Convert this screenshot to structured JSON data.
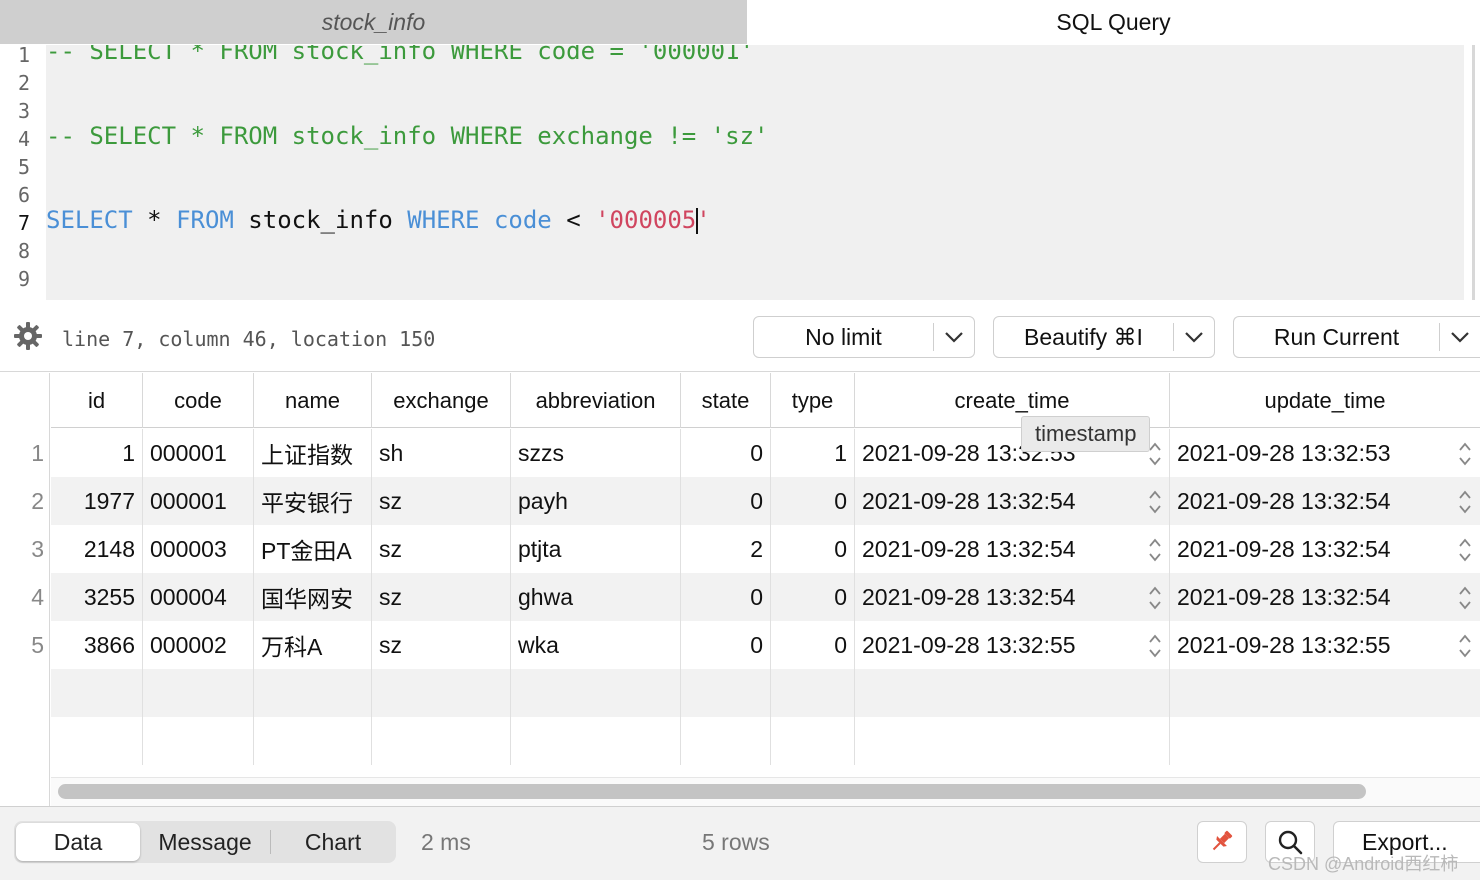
{
  "tabs": [
    {
      "label": "stock_info",
      "active": false
    },
    {
      "label": "SQL Query",
      "active": true
    }
  ],
  "editor": {
    "line_numbers": [
      "1",
      "2",
      "3",
      "4",
      "5",
      "6",
      "7",
      "8",
      "9"
    ],
    "current_line": "7",
    "lines": {
      "l1": "-- SELECT * FROM stock_info WHERE code = '000001'",
      "l4": "-- SELECT * FROM stock_info WHERE exchange != 'sz'",
      "l7_kw1": "SELECT",
      "l7_p1": " * ",
      "l7_kw2": "FROM",
      "l7_p2": " stock_info ",
      "l7_kw3": "WHERE",
      "l7_p3": " ",
      "l7_kw4": "code",
      "l7_p4": " < ",
      "l7_str_a": "'000005",
      "l7_str_b": "'"
    }
  },
  "toolbar": {
    "cursor_status": "line 7, column 46, location 150",
    "limit_label": "No limit",
    "beautify_label": "Beautify ⌘I",
    "run_label": "Run Current"
  },
  "grid": {
    "columns": [
      "id",
      "code",
      "name",
      "exchange",
      "abbreviation",
      "state",
      "type",
      "create_time",
      "update_time"
    ],
    "rows": [
      {
        "num": "1",
        "id": "1",
        "code": "000001",
        "name": "上证指数",
        "exchange": "sh",
        "abbreviation": "szzs",
        "state": "0",
        "type": "1",
        "create_time": "2021-09-28 13:32:53",
        "update_time": "2021-09-28 13:32:53"
      },
      {
        "num": "2",
        "id": "1977",
        "code": "000001",
        "name": "平安银行",
        "exchange": "sz",
        "abbreviation": "payh",
        "state": "0",
        "type": "0",
        "create_time": "2021-09-28 13:32:54",
        "update_time": "2021-09-28 13:32:54"
      },
      {
        "num": "3",
        "id": "2148",
        "code": "000003",
        "name": "PT金田A",
        "exchange": "sz",
        "abbreviation": "ptjta",
        "state": "2",
        "type": "0",
        "create_time": "2021-09-28 13:32:54",
        "update_time": "2021-09-28 13:32:54"
      },
      {
        "num": "4",
        "id": "3255",
        "code": "000004",
        "name": "国华网安",
        "exchange": "sz",
        "abbreviation": "ghwa",
        "state": "0",
        "type": "0",
        "create_time": "2021-09-28 13:32:54",
        "update_time": "2021-09-28 13:32:54"
      },
      {
        "num": "5",
        "id": "3866",
        "code": "000002",
        "name": "万科A",
        "exchange": "sz",
        "abbreviation": "wka",
        "state": "0",
        "type": "0",
        "create_time": "2021-09-28 13:32:55",
        "update_time": "2021-09-28 13:32:55"
      }
    ],
    "tooltip": "timestamp"
  },
  "footer": {
    "tabs": [
      "Data",
      "Message",
      "Chart"
    ],
    "selected_tab": "Data",
    "duration": "2 ms",
    "row_count": "5 rows",
    "export_label": "Export..."
  },
  "watermark": "CSDN @Android西红柿",
  "colors": {
    "comment": "#3c9a3c",
    "keyword": "#4a8fd6",
    "string": "#d0455f",
    "pin": "#e2533e"
  }
}
